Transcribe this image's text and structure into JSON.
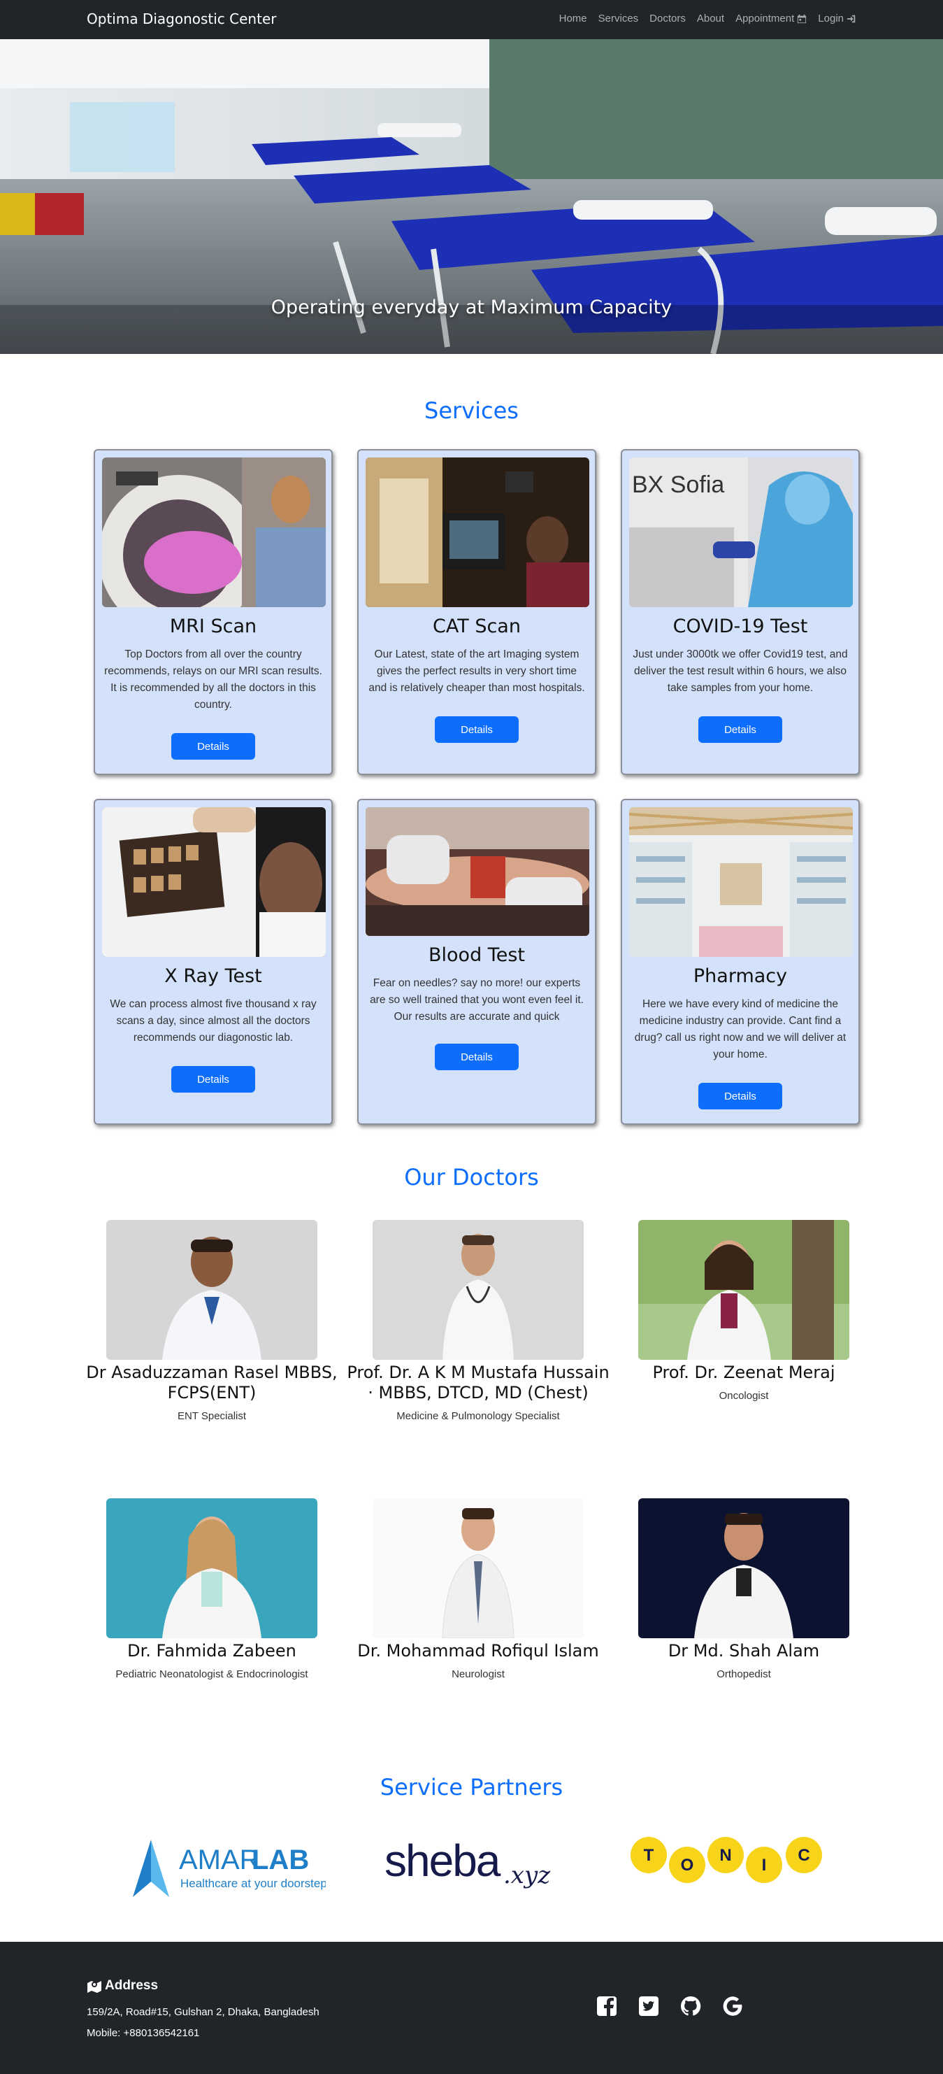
{
  "navbar": {
    "brand": "Optima Diagonostic Center",
    "links": [
      "Home",
      "Services",
      "Doctors",
      "About",
      "Appointment",
      "Login"
    ]
  },
  "hero": {
    "caption": "Operating everyday at Maximum Capacity"
  },
  "services": {
    "title": "Services",
    "cards": [
      {
        "title": "MRI Scan",
        "text": "Top Doctors from all over the country recommends, relays on our MRI scan results. It is recommended by all the doctors in this country.",
        "button": "Details"
      },
      {
        "title": "CAT Scan",
        "text": "Our Latest, state of the art Imaging system gives the perfect results in very short time and is relatively cheaper than most hospitals.",
        "button": "Details"
      },
      {
        "title": "COVID-19 Test",
        "text": "Just under 3000tk we offer Covid19 test, and deliver the test result within 6 hours, we also take samples from your home.",
        "button": "Details"
      },
      {
        "title": "X Ray Test",
        "text": "We can process almost five thousand x ray scans a day, since almost all the doctors recommends our diagonostic lab.",
        "button": "Details"
      },
      {
        "title": "Blood Test",
        "text": "Fear on needles? say no more! our experts are so well trained that you wont even feel it. Our results are accurate and quick",
        "button": "Details"
      },
      {
        "title": "Pharmacy",
        "text": "Here we have every kind of medicine the medicine industry can provide. Cant find a drug? call us right now and we will deliver at your home.",
        "button": "Details"
      }
    ]
  },
  "doctors": {
    "title": "Our Doctors",
    "list": [
      {
        "name": "Dr Asaduzzaman Rasel MBBS, FCPS(ENT)",
        "specialty": "ENT Specialist"
      },
      {
        "name": "Prof. Dr. A K M Mustafa Hussain · MBBS, DTCD, MD (Chest)",
        "specialty": "Medicine & Pulmonology Specialist"
      },
      {
        "name": "Prof. Dr. Zeenat Meraj",
        "specialty": "Oncologist"
      },
      {
        "name": "Dr. Fahmida Zabeen",
        "specialty": "Pediatric Neonatologist & Endocrinologist"
      },
      {
        "name": "Dr. Mohammad Rofiqul Islam",
        "specialty": "Neurologist"
      },
      {
        "name": "Dr Md. Shah Alam",
        "specialty": "Orthopedist"
      }
    ]
  },
  "partners": {
    "title": "Service Partners",
    "amarlab": {
      "part1": "AMAR",
      "part2": "LAB",
      "tagline": "Healthcare at your doorstep"
    },
    "sheba": {
      "main": "sheba",
      "suffix": ".xyz"
    },
    "tonic": {
      "letters": [
        "T",
        "O",
        "N",
        "I",
        "C"
      ]
    }
  },
  "footer": {
    "heading": "Address",
    "address": "159/2A, Road#15, Gulshan 2, Dhaka, Bangladesh",
    "mobile": "Mobile: +880136542161",
    "socials": [
      "facebook-icon",
      "twitter-icon",
      "github-icon",
      "google-icon"
    ]
  },
  "colors": {
    "primary": "#0d6efd",
    "dark": "#212529",
    "card_bg": "#d3e2fa",
    "tonic_yellow": "#f7d31a",
    "amarlab_blue": "#1e7fc8",
    "sheba_navy": "#151a4a"
  }
}
